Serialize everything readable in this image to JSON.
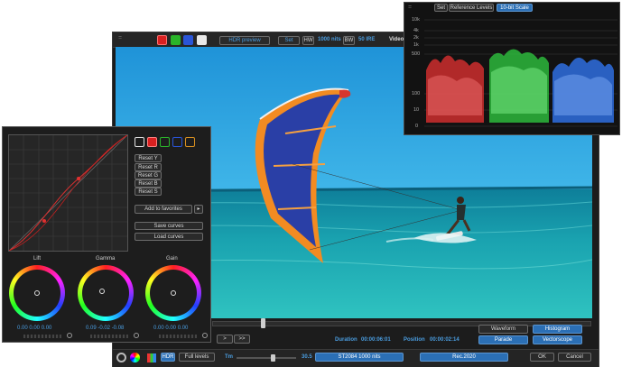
{
  "main": {
    "top_toolbar": {
      "grip": "::::::::",
      "swatch_colors": [
        "#d92020",
        "#2ab52a",
        "#2a55d8",
        "#e8e8e8"
      ],
      "hdr_preview_label": "HDR preview",
      "set_label": "Set",
      "nits_value": "1000 nits",
      "bw_label": "BW",
      "ire_value": "50 IRE",
      "video_label": "Video"
    },
    "transport": {
      "duration_label": "Duration",
      "duration_value": "00:00:06:01",
      "position_label": "Position",
      "position_value": "00:00:02:14",
      "next_label": ">",
      "fast_forward_label": ">>",
      "playhead": 0.28
    },
    "scope_buttons": {
      "waveform": "Waveform",
      "histogram": "Histogram",
      "parade": "Parade",
      "vectorscope": "Vectorscope"
    },
    "bottom_bar": {
      "hdr_label": "HDR",
      "full_levels_label": "Full levels",
      "tm_label": "Tm",
      "tm_value": "30.5",
      "tm_level": 0.6,
      "transfer_value": "ST2084 1000 nits",
      "gamut_value": "Rec.2020",
      "ok_label": "OK",
      "cancel_label": "Cancel"
    }
  },
  "curves_panel": {
    "swatch_colors": [
      "#e0e0e0",
      "#d92020",
      "#2ab52a",
      "#2a55d8",
      "#d89020"
    ],
    "reset_y": "Reset Y",
    "reset_r": "Reset R",
    "reset_g": "Reset G",
    "reset_b": "Reset B",
    "reset_s": "Reset S",
    "add_to_favorites": "Add to favorites",
    "save_curves": "Save curves",
    "load_curves": "Load curves",
    "wheels": [
      {
        "label": "Lift",
        "values": "0.00  0.00  0.00"
      },
      {
        "label": "Gamma",
        "values": "0.09  -0.02  -0.08"
      },
      {
        "label": "Gain",
        "values": "0.00  0.00  0.00"
      }
    ]
  },
  "scope": {
    "grip": "::::::::",
    "set_label": "Set",
    "reference_levels_label": "Reference Levels",
    "scale_label": "10-bit Scale",
    "tick_labels": [
      "10k",
      "4k",
      "2k",
      "1k",
      "500",
      "100",
      "10",
      "0"
    ],
    "channel_colors": [
      "#e23a3a",
      "#36d84a",
      "#3a7ae8"
    ]
  }
}
